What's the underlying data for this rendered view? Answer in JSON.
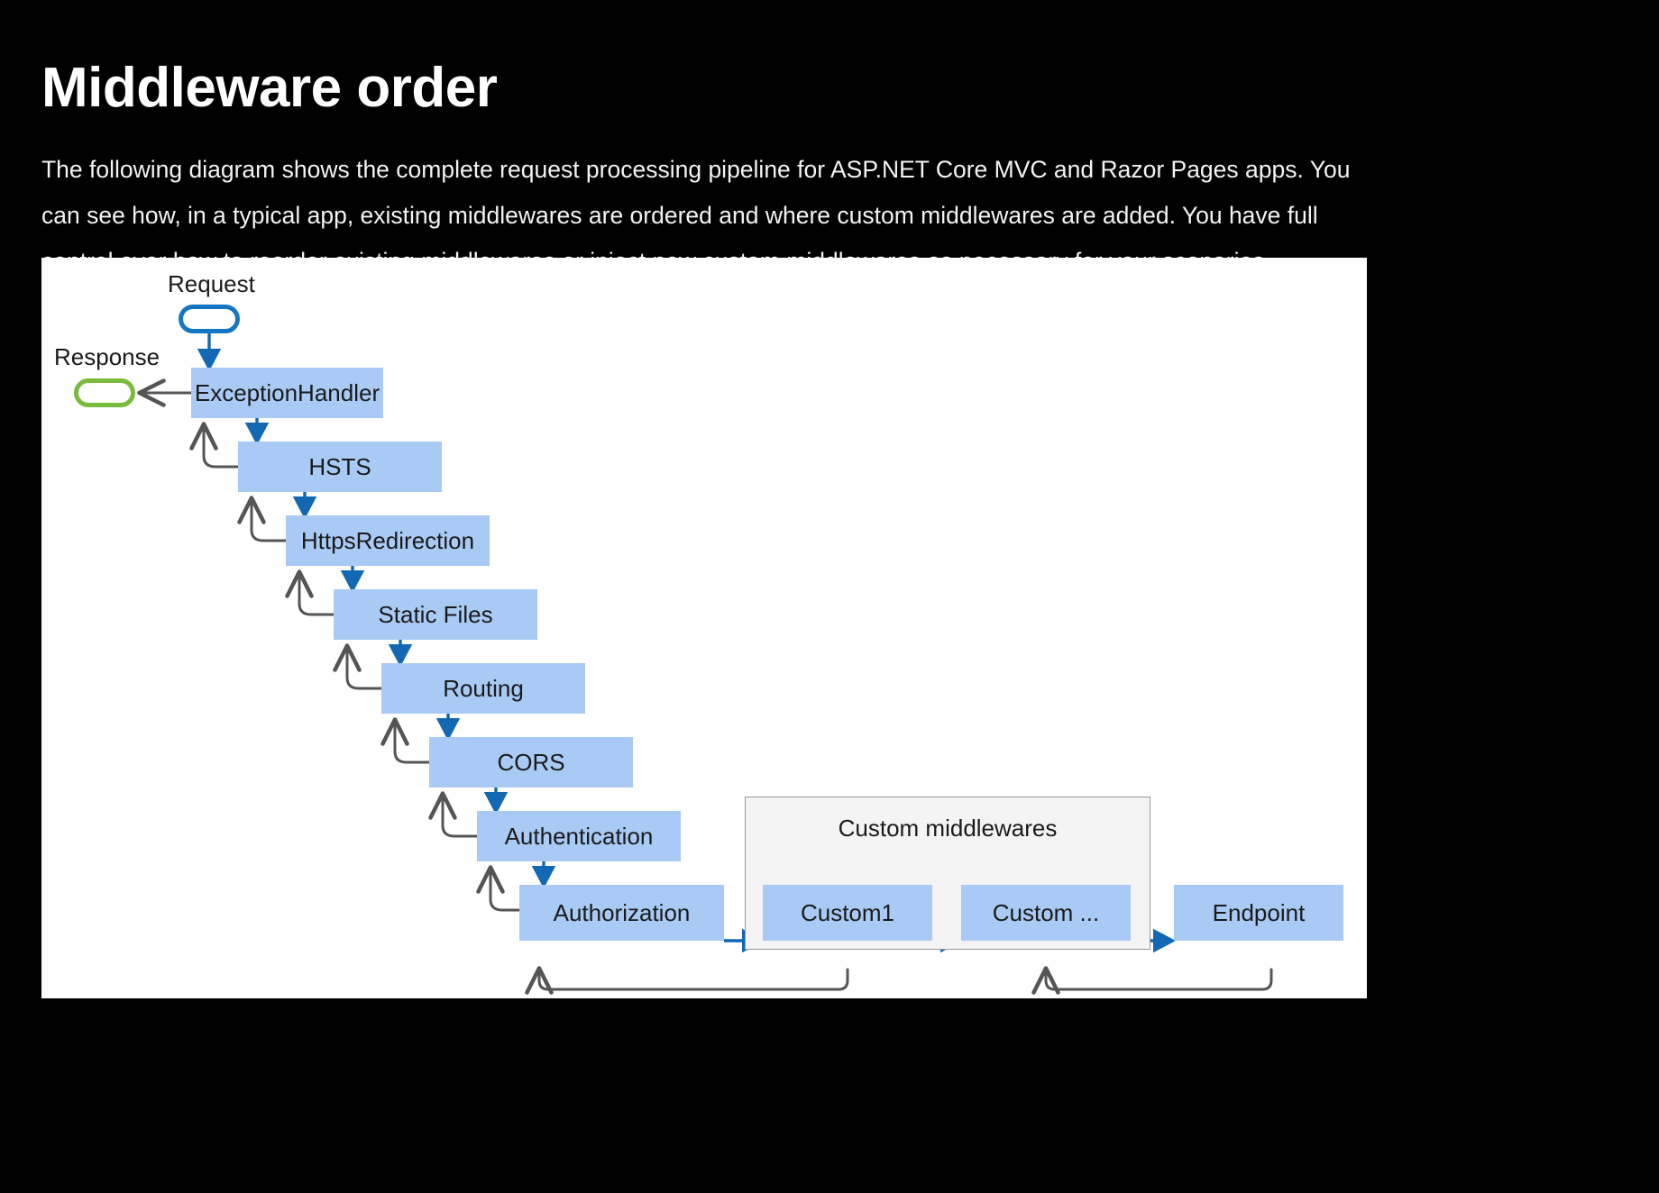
{
  "page": {
    "title": "Middleware order",
    "intro": "The following diagram shows the complete request processing pipeline for ASP.NET Core MVC and Razor Pages apps. You can see how, in a typical app, existing middlewares are ordered and where custom middlewares are added. You have full control over how to reorder existing middlewares or inject new custom middlewares as necessary for your scenarios."
  },
  "colors": {
    "background": "#000000",
    "panel": "#ffffff",
    "node_fill": "#a9caf5",
    "forward_arrow": "#1268b3",
    "return_arrow": "#555555",
    "request_outline": "#1575c0",
    "response_outline": "#79bc3d",
    "group_fill": "#f4f4f4",
    "group_border": "#9a9a9a",
    "text": "#1a1a1a",
    "page_text": "#ffffff"
  },
  "diagram": {
    "type": "flowchart",
    "labels": {
      "request": "Request",
      "response": "Response",
      "custom_group": "Custom middlewares"
    },
    "nodes": [
      {
        "id": "exception-handler",
        "label": "ExceptionHandler"
      },
      {
        "id": "hsts",
        "label": "HSTS"
      },
      {
        "id": "https-redirection",
        "label": "HttpsRedirection"
      },
      {
        "id": "static-files",
        "label": "Static Files"
      },
      {
        "id": "routing",
        "label": "Routing"
      },
      {
        "id": "cors",
        "label": "CORS"
      },
      {
        "id": "authentication",
        "label": "Authentication"
      },
      {
        "id": "authorization",
        "label": "Authorization"
      },
      {
        "id": "custom1",
        "label": "Custom1"
      },
      {
        "id": "custom-ellipsis",
        "label": "Custom ..."
      },
      {
        "id": "endpoint",
        "label": "Endpoint"
      }
    ],
    "forward_edges": [
      {
        "from": "request",
        "to": "exception-handler"
      },
      {
        "from": "exception-handler",
        "to": "hsts"
      },
      {
        "from": "hsts",
        "to": "https-redirection"
      },
      {
        "from": "https-redirection",
        "to": "static-files"
      },
      {
        "from": "static-files",
        "to": "routing"
      },
      {
        "from": "routing",
        "to": "cors"
      },
      {
        "from": "cors",
        "to": "authentication"
      },
      {
        "from": "authentication",
        "to": "authorization"
      },
      {
        "from": "authorization",
        "to": "custom1"
      },
      {
        "from": "custom1",
        "to": "custom-ellipsis"
      },
      {
        "from": "custom-ellipsis",
        "to": "endpoint"
      }
    ],
    "return_edges": [
      {
        "from": "exception-handler",
        "to": "response"
      },
      {
        "from": "hsts",
        "to": "exception-handler"
      },
      {
        "from": "https-redirection",
        "to": "hsts"
      },
      {
        "from": "static-files",
        "to": "https-redirection"
      },
      {
        "from": "routing",
        "to": "static-files"
      },
      {
        "from": "cors",
        "to": "routing"
      },
      {
        "from": "authentication",
        "to": "cors"
      },
      {
        "from": "authorization",
        "to": "authentication"
      },
      {
        "from": "custom1",
        "to": "authorization"
      },
      {
        "from": "custom-ellipsis",
        "to": "custom1"
      },
      {
        "from": "endpoint",
        "to": "custom-ellipsis"
      }
    ]
  }
}
